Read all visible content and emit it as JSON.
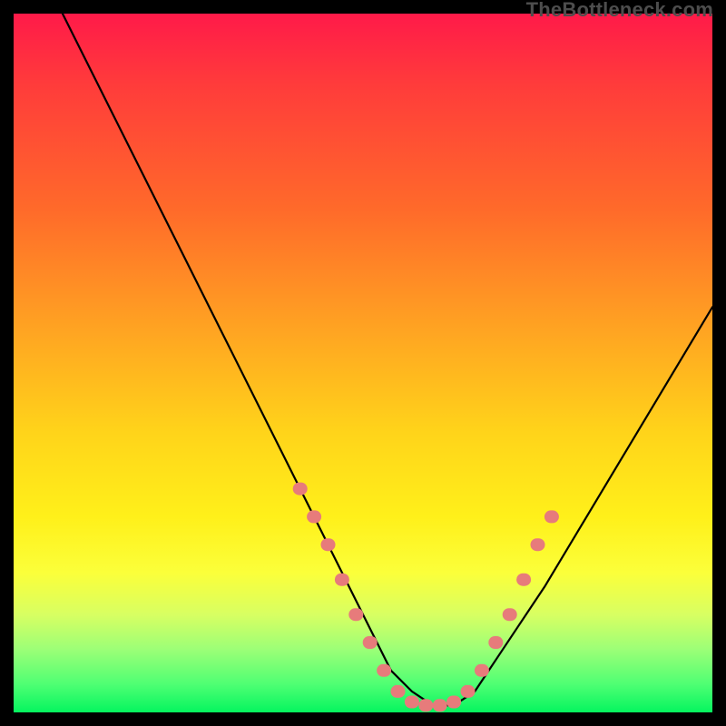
{
  "watermark": "TheBottleneck.com",
  "chart_data": {
    "type": "line",
    "title": "",
    "xlabel": "",
    "ylabel": "",
    "xlim": [
      0,
      100
    ],
    "ylim": [
      0,
      100
    ],
    "grid": false,
    "legend": false,
    "background_gradient": {
      "direction": "vertical",
      "stops": [
        {
          "pos": 0,
          "color": "#ff1a49"
        },
        {
          "pos": 45,
          "color": "#ffa322"
        },
        {
          "pos": 72,
          "color": "#fff01a"
        },
        {
          "pos": 100,
          "color": "#05f55f"
        }
      ]
    },
    "series": [
      {
        "name": "bottleneck-curve",
        "color": "#000000",
        "x": [
          7,
          12,
          18,
          24,
          30,
          36,
          40,
          44,
          48,
          52,
          54,
          57,
          60,
          63,
          66,
          70,
          76,
          82,
          88,
          94,
          100
        ],
        "y": [
          100,
          90,
          78,
          66,
          54,
          42,
          34,
          26,
          18,
          10,
          6,
          3,
          1,
          1,
          3,
          9,
          18,
          28,
          38,
          48,
          58
        ]
      }
    ],
    "markers": {
      "color": "#e77b7b",
      "shape": "rounded-rect",
      "points": [
        {
          "x": 41,
          "y": 32
        },
        {
          "x": 43,
          "y": 28
        },
        {
          "x": 45,
          "y": 24
        },
        {
          "x": 47,
          "y": 19
        },
        {
          "x": 49,
          "y": 14
        },
        {
          "x": 51,
          "y": 10
        },
        {
          "x": 53,
          "y": 6
        },
        {
          "x": 55,
          "y": 3
        },
        {
          "x": 57,
          "y": 1.5
        },
        {
          "x": 59,
          "y": 1
        },
        {
          "x": 61,
          "y": 1
        },
        {
          "x": 63,
          "y": 1.5
        },
        {
          "x": 65,
          "y": 3
        },
        {
          "x": 67,
          "y": 6
        },
        {
          "x": 69,
          "y": 10
        },
        {
          "x": 71,
          "y": 14
        },
        {
          "x": 73,
          "y": 19
        },
        {
          "x": 75,
          "y": 24
        },
        {
          "x": 77,
          "y": 28
        }
      ]
    }
  }
}
